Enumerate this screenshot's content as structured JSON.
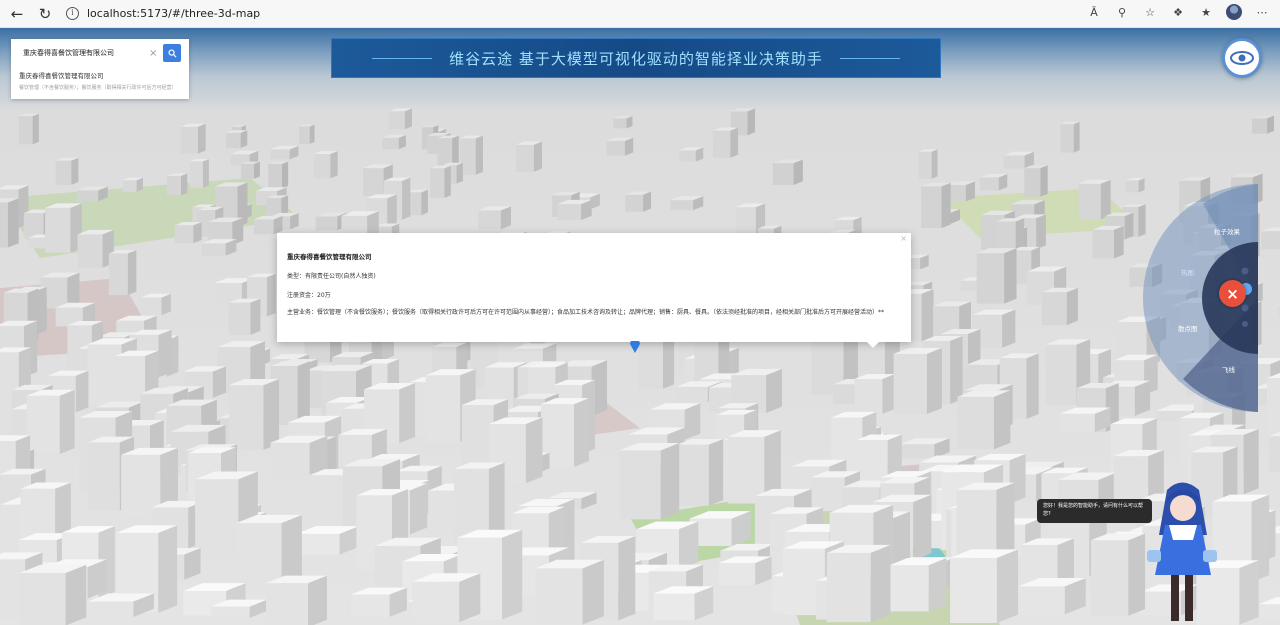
{
  "browser": {
    "url": "localhost:5173/#/three-3d-map",
    "read_aloud_label": "Ā"
  },
  "search": {
    "query": "重庆春得喜餐饮管理有限公司",
    "result_title": "重庆春得喜餐饮管理有限公司",
    "result_subtitle": "餐饮管理（不含餐饮服务）；餐饮服务（取得相关行政许可后方可经营）"
  },
  "banner": {
    "title": "维谷云途 基于大模型可视化驱动的智能择业决策助手"
  },
  "popup": {
    "company": "重庆春得喜餐饮管理有限公司",
    "type": "类型：有限责任公司(自然人独资)",
    "capital": "注册资金：20万",
    "scope": "主营业务：餐饮管理（不含餐饮服务）；餐饮服务（取得相关行政许可后方可在许可范围内从事经营）；食品加工技术咨询及转让；品牌代理；销售：厨具、餐具。（依法须经批准的项目，经相关部门批准后方可开展经营活动）**"
  },
  "radial_menu": {
    "items": [
      {
        "label": "粒子效果"
      },
      {
        "label": "热图"
      },
      {
        "label": "散点图"
      },
      {
        "label": "飞线"
      }
    ],
    "close_label": "×"
  },
  "assistant": {
    "greeting": "您好！我是您的智能助手，请问有什么可以帮您?"
  },
  "colors": {
    "banner_bg": "#154a86",
    "banner_text": "#9fe0ff",
    "search_button": "#3d7fe0",
    "close_button": "#e8503d",
    "map_marker": "#2f7be0"
  }
}
